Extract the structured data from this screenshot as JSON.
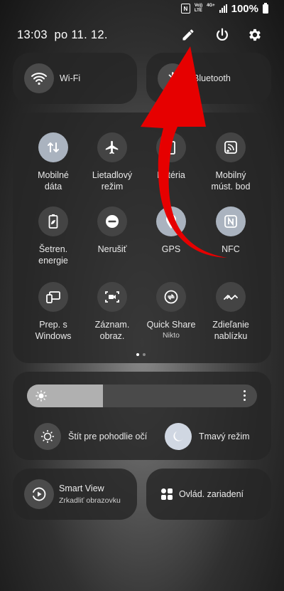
{
  "status_bar": {
    "network_line1": "Vo))",
    "network_line2": "LTE",
    "network_line3": "4G+",
    "battery": "100%",
    "nfc_glyph": "N"
  },
  "header": {
    "datetime": "13:03  po 11. 12."
  },
  "quick_panels": {
    "wifi": "Wi-Fi",
    "bluetooth": "Bluetooth"
  },
  "tiles": [
    {
      "label": "Mobilné\ndáta",
      "icon": "mobile-data-icon",
      "active": true
    },
    {
      "label": "Lietadlový\nrežim",
      "icon": "airplane-icon",
      "active": false
    },
    {
      "label": "Batéria",
      "icon": "battery-icon",
      "active": false
    },
    {
      "label": "Mobilný\nmúst. bod",
      "icon": "hotspot-icon",
      "active": false
    },
    {
      "label": "Šetren.\nenergie",
      "icon": "power-saving-icon",
      "active": false
    },
    {
      "label": "Nerušiť",
      "icon": "do-not-disturb-icon",
      "active": false
    },
    {
      "label": "GPS",
      "icon": "location-icon",
      "active": true
    },
    {
      "label": "NFC",
      "icon": "nfc-icon",
      "active": true
    },
    {
      "label": "Prep. s\nWindows",
      "icon": "link-windows-icon",
      "active": false
    },
    {
      "label": "Záznam.\nobraz.",
      "icon": "screen-record-icon",
      "active": false
    },
    {
      "label": "Quick Share",
      "sub": "Nikto",
      "icon": "quick-share-icon",
      "active": false
    },
    {
      "label": "Zdieľanie\nnablízku",
      "icon": "nearby-share-icon",
      "active": false
    }
  ],
  "brightness": {
    "level": 0.33
  },
  "eye_comfort": "Štít pre pohodlie očí",
  "dark_mode": "Tmavý režim",
  "smart_view": {
    "title": "Smart View",
    "subtitle": "Zrkadliť obrazovku"
  },
  "device_control": "Ovlád. zariadení",
  "colors": {
    "annotation_arrow": "#e60000",
    "active_tile": "#aab3bf"
  }
}
